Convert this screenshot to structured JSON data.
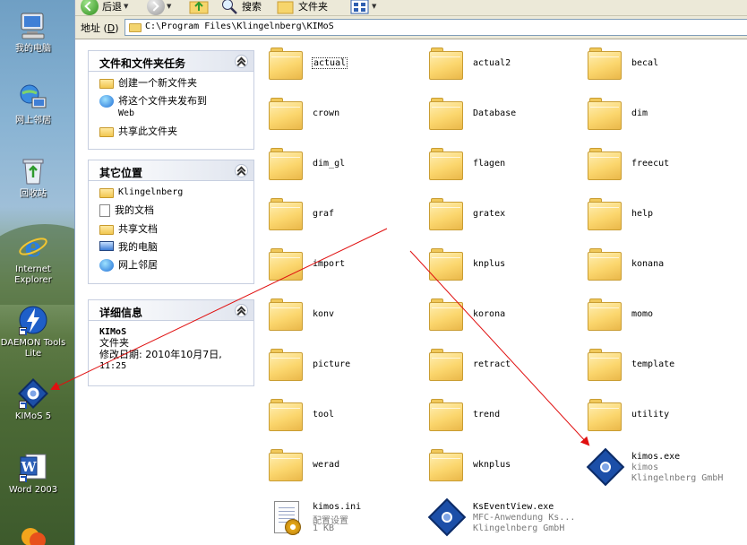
{
  "toolbar": {
    "back_label": "后退",
    "search_label": "搜索",
    "folders_label": "文件夹"
  },
  "address": {
    "label": "地址",
    "label_key": "D",
    "path": "C:\\Program Files\\Klingelnberg\\KIMoS"
  },
  "desktop": {
    "icons": [
      {
        "label": "我的电脑",
        "icon": "my-computer-icon"
      },
      {
        "label": "网上邻居",
        "icon": "network-places-icon"
      },
      {
        "label": "回收站",
        "icon": "recycle-bin-icon"
      },
      {
        "label": "Internet Explorer",
        "icon": "internet-explorer-icon"
      },
      {
        "label": "DAEMON Tools Lite",
        "icon": "daemon-tools-icon"
      },
      {
        "label": "KIMoS 5",
        "icon": "kimos-icon"
      },
      {
        "label": "Word 2003",
        "icon": "word-icon"
      }
    ]
  },
  "taskpane": {
    "tasks": {
      "title": "文件和文件夹任务",
      "items": [
        {
          "label": "创建一个新文件夹",
          "icon": "new-folder-icon"
        },
        {
          "label": "将这个文件夹发布到",
          "label2": "Web",
          "icon": "publish-web-icon"
        },
        {
          "label": "共享此文件夹",
          "icon": "share-folder-icon"
        }
      ]
    },
    "places": {
      "title": "其它位置",
      "items": [
        {
          "label": "Klingelnberg",
          "icon": "folder-icon"
        },
        {
          "label": "我的文档",
          "icon": "my-documents-icon"
        },
        {
          "label": "共享文档",
          "icon": "shared-documents-icon"
        },
        {
          "label": "我的电脑",
          "icon": "my-computer-icon"
        },
        {
          "label": "网上邻居",
          "icon": "network-places-icon"
        }
      ]
    },
    "details": {
      "title": "详细信息",
      "name": "KIMoS",
      "type": "文件夹",
      "modified": "修改日期: 2010年10月7日,",
      "modified_time": "11:25"
    }
  },
  "files": {
    "folders": [
      "actual",
      "actual2",
      "becal",
      "crown",
      "Database",
      "dim",
      "dim_gl",
      "flagen",
      "freecut",
      "graf",
      "gratex",
      "help",
      "import",
      "knplus",
      "konana",
      "konv",
      "korona",
      "momo",
      "picture",
      "retract",
      "template",
      "tool",
      "trend",
      "utility",
      "werad",
      "wknplus"
    ],
    "kimos_exe": {
      "name": "kimos.exe",
      "line2": "kimos",
      "line3": "Klingelnberg GmbH"
    },
    "kimos_ini": {
      "name": "kimos.ini",
      "line2": "配置设置",
      "line3": "1 KB"
    },
    "ksevent": {
      "name": "KsEventView.exe",
      "line2": "MFC-Anwendung Ks...",
      "line3": "Klingelnberg GmbH"
    }
  },
  "colors": {
    "arrow": "#e01010",
    "panel_border": "#c7cfe0",
    "folder_fill": "#fbd66d"
  }
}
